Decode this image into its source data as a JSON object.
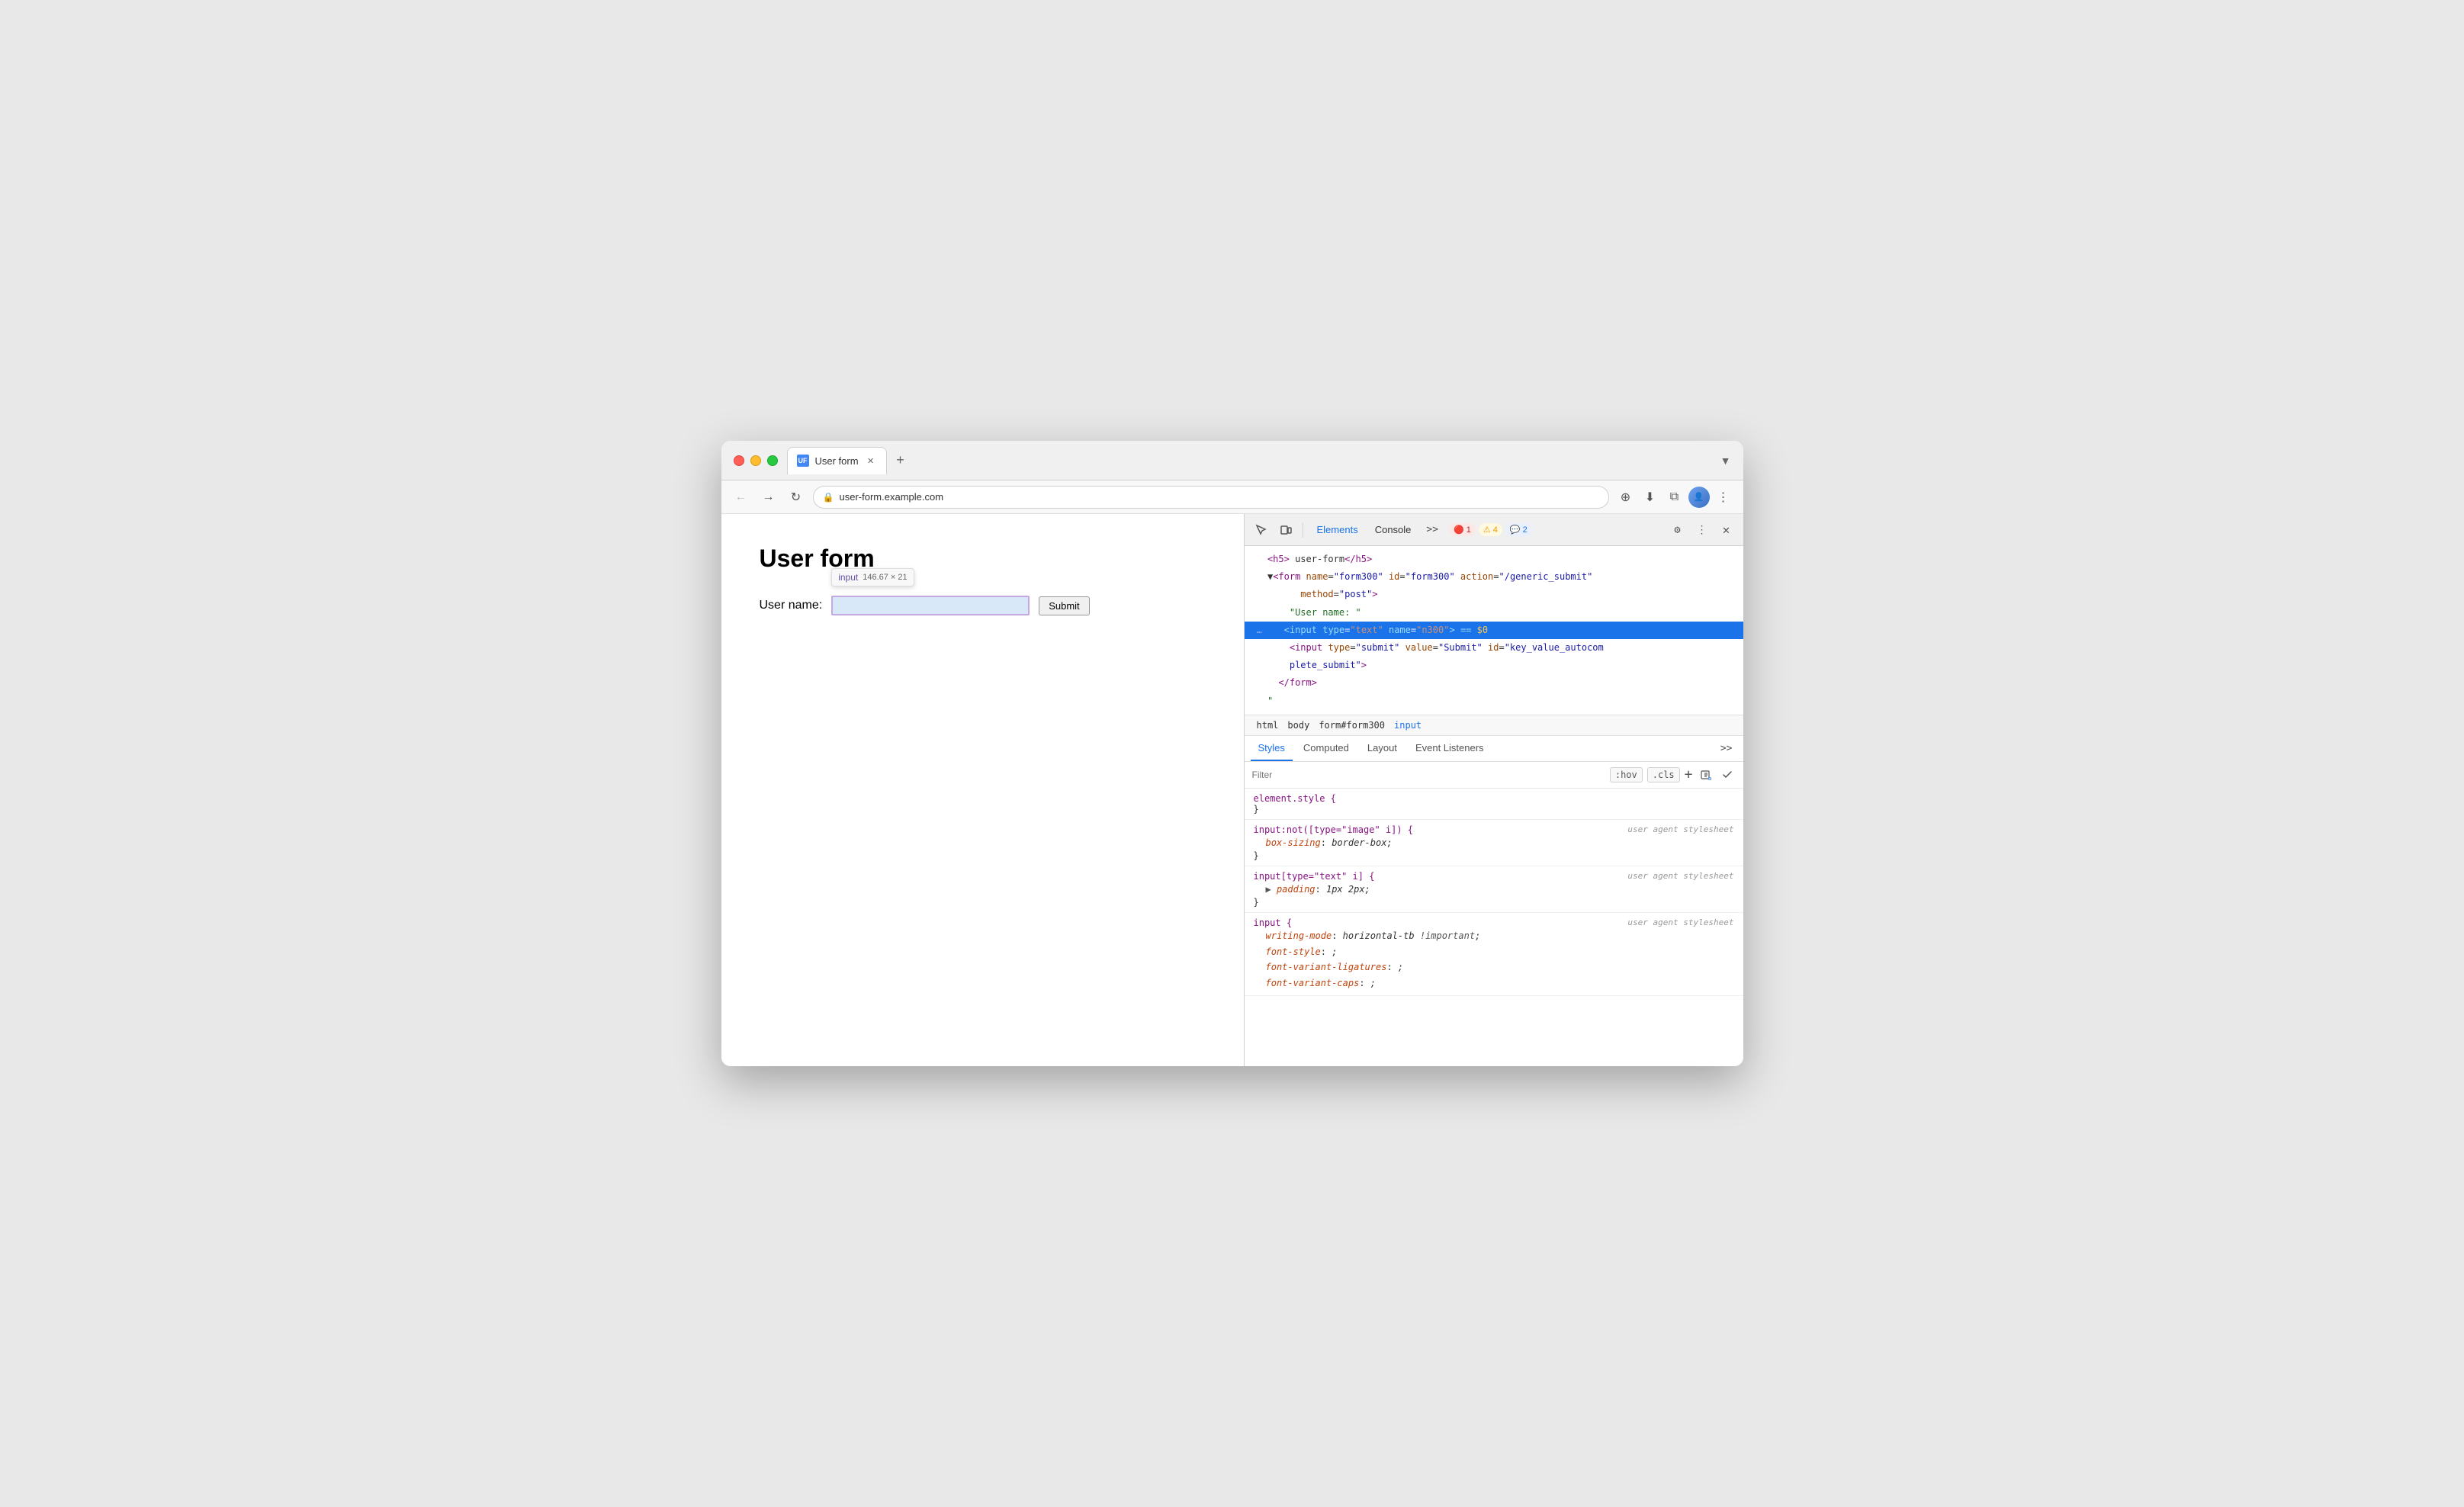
{
  "browser": {
    "tab_title": "User form",
    "tab_favicon": "UF",
    "address": "user-form.example.com",
    "dropdown_icon": "▼"
  },
  "webpage": {
    "title": "User form",
    "form_label": "User name:",
    "submit_label": "Submit",
    "tooltip_tag": "input",
    "tooltip_size": "146.67 × 21"
  },
  "devtools": {
    "tabs": [
      "Elements",
      "Console"
    ],
    "active_tab": "Elements",
    "badges": {
      "error_icon": "🔴",
      "error_count": "1",
      "warn_icon": "⚠️",
      "warn_count": "4",
      "info_icon": "💬",
      "info_count": "2"
    },
    "dom": {
      "line1": "<h5> user-form</h5>",
      "line2_pre": "▼",
      "line2": "<form name=\"form300\" id=\"form300\" action=\"/generic_submit\"",
      "line3": "method=\"post\">",
      "line4": "\"User name: \"",
      "line5_selected": "<input type=\"text\" name=\"n300\"> == $0",
      "line6": "<input type=\"submit\" value=\"Submit\" id=\"key_value_autocom",
      "line7": "plete_submit\">",
      "line8": "</form>",
      "line9": "\""
    },
    "breadcrumbs": [
      "html",
      "body",
      "form#form300",
      "input"
    ],
    "style_tabs": [
      "Styles",
      "Computed",
      "Layout",
      "Event Listeners"
    ],
    "active_style_tab": "Styles",
    "filter_placeholder": "Filter",
    "filter_hov": ":hov",
    "filter_cls": ".cls",
    "css_blocks": [
      {
        "selector": "element.style {",
        "source": "",
        "properties": [],
        "close": "}"
      },
      {
        "selector": "input:not([type=\"image\" i]) {",
        "source": "user agent stylesheet",
        "properties": [
          {
            "name": "box-sizing",
            "colon": ":",
            "value": "border-box;"
          }
        ],
        "close": "}"
      },
      {
        "selector": "input[type=\"text\" i] {",
        "source": "user agent stylesheet",
        "properties": [
          {
            "name": "padding",
            "colon": ":",
            "arrow": "▶",
            "value": "1px 2px;"
          }
        ],
        "close": "}"
      },
      {
        "selector": "input {",
        "source": "user agent stylesheet",
        "properties": [
          {
            "name": "writing-mode",
            "colon": ":",
            "value": "horizontal-tb !important;"
          },
          {
            "name": "font-style",
            "colon": ":",
            "value": ";"
          },
          {
            "name": "font-variant-ligatures",
            "colon": ":",
            "value": ";"
          },
          {
            "name": "font-variant-caps",
            "colon": ":",
            "value": ";"
          }
        ],
        "close": "}"
      }
    ]
  }
}
